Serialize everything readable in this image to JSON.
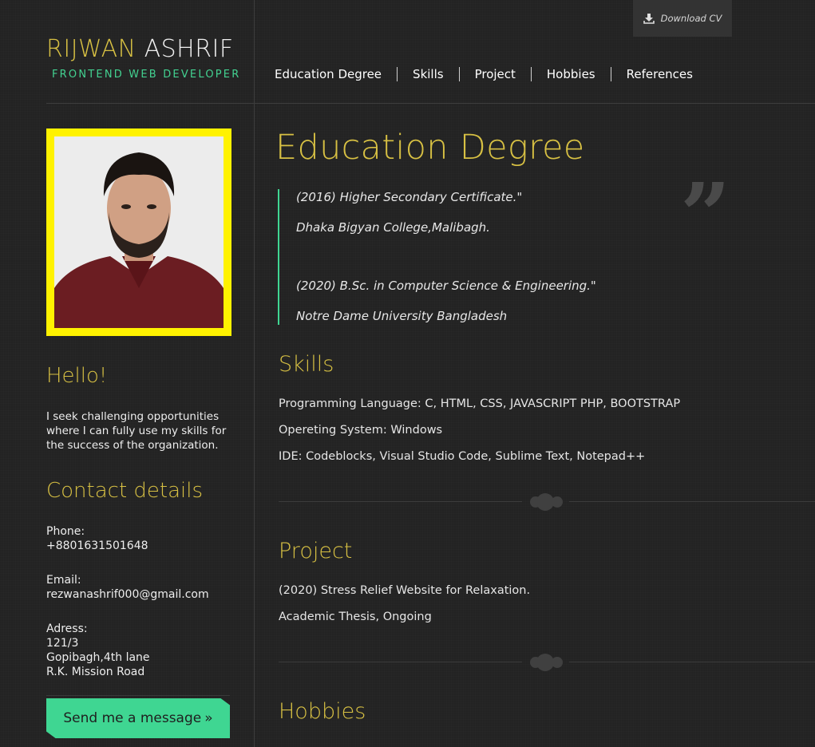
{
  "brand": {
    "first": "RIJWAN",
    "last": "ASHRIF",
    "role": "FRONTEND WEB DEVELOPER"
  },
  "download": {
    "label": "Download CV",
    "icon": "download-icon"
  },
  "nav": [
    "Education Degree",
    "Skills",
    "Project",
    "Hobbies",
    "References"
  ],
  "sidebar": {
    "hello_title": "Hello!",
    "intro": "I seek challenging opportunities where I can fully use my skills for the success of the organization.",
    "contact_title": "Contact details",
    "phone_label": "Phone:",
    "phone": "+8801631501648",
    "email_label": "Email:",
    "email": "rezwanashrif000@gmail.com",
    "address_label": "Adress:",
    "address_1": "121/3",
    "address_2": "Gopibagh,4th lane",
    "address_3": "R.K. Mission Road",
    "send_label": "Send me a message",
    "send_icon": "»"
  },
  "education": {
    "title": "Education Degree",
    "entries": [
      {
        "degree": "(2016) Higher Secondary Certificate.\"",
        "school": "Dhaka Bigyan College,Malibagh."
      },
      {
        "degree": "(2020) B.Sc. in Computer Science & Engineering.\"",
        "school": "Notre Dame University Bangladesh"
      }
    ],
    "quote_mark": "”"
  },
  "skills": {
    "title": "Skills",
    "lines": [
      "Programming Language: C, HTML, CSS, JAVASCRIPT PHP, BOOTSTRAP",
      "Opereting System: Windows",
      "IDE: Codeblocks, Visual Studio Code, Sublime Text, Notepad++"
    ]
  },
  "project": {
    "title": "Project",
    "lines": [
      "(2020) Stress Relief Website for Relaxation.",
      "Academic Thesis, Ongoing"
    ]
  },
  "hobbies": {
    "title": "Hobbies"
  },
  "colors": {
    "accent_gold": "#d7c043",
    "accent_green": "#3fd692",
    "photo_frame": "#fff200",
    "background": "#232323"
  }
}
